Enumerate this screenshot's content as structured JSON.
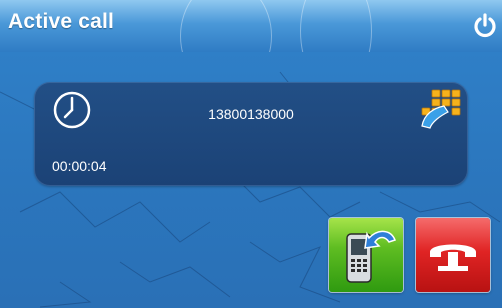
{
  "header": {
    "title": "Active call",
    "power_icon": "power-icon"
  },
  "call": {
    "number": "13800138000",
    "duration": "00:00:04",
    "clock_icon": "clock-icon",
    "keypad_icon": "keypad-icon"
  },
  "actions": {
    "transfer_icon": "phone-transfer-icon",
    "hangup_icon": "hang-up-icon"
  },
  "colors": {
    "header_blue": "#3f8fd2",
    "body_blue": "#2b76bd",
    "panel_navy": "#1f4a80",
    "accept_green": "#4caf1c",
    "hangup_red": "#d91e1e"
  }
}
